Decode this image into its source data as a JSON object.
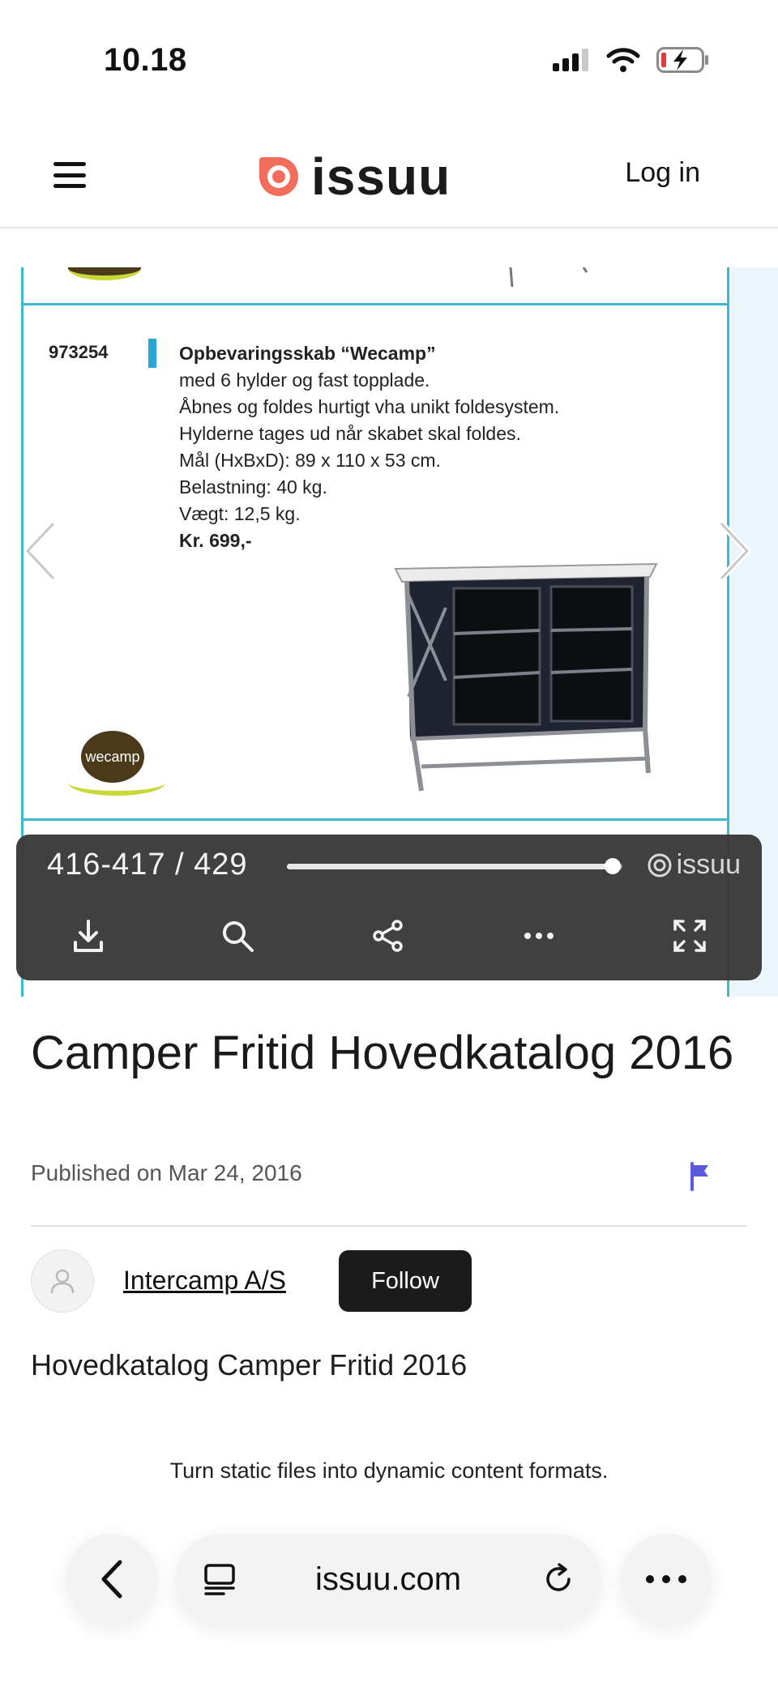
{
  "status_bar": {
    "time": "10.18",
    "battery_state": "charging-low"
  },
  "header": {
    "brand": "issuu",
    "login_label": "Log in",
    "brand_color": "#F36D5D"
  },
  "document_page": {
    "item_number": "973254",
    "lines": {
      "title": "Opbevaringsskab “Wecamp”",
      "l1": "med 6 hylder og fast topplade.",
      "l2": "Åbnes og foldes hurtigt vha unikt foldesystem.",
      "l3": "Hylderne tages ud når skabet skal foldes.",
      "l4": "Mål (HxBxD): 89 x 110 x 53 cm.",
      "l5": "Belastning: 40 kg.",
      "l6": "Vægt: 12,5 kg.",
      "price": "Kr. 699,-"
    },
    "badge_text": "wecamp"
  },
  "toolbar": {
    "page_indicator": "416-417 / 429",
    "progress": 0.97,
    "brand": "issuu",
    "actions": [
      "download-icon",
      "search-icon",
      "share-icon",
      "more-icon",
      "fullscreen-icon"
    ]
  },
  "meta": {
    "title": "Camper Fritid Hovedkatalog 2016",
    "published": "Published on Mar 24, 2016",
    "publisher": "Intercamp A/S",
    "follow_label": "Follow",
    "description": "Hovedkatalog Camper Fritid 2016",
    "flag_color": "#5a5adf"
  },
  "promo_text": "Turn static files into dynamic content formats.",
  "browser": {
    "url": "issuu.com"
  }
}
